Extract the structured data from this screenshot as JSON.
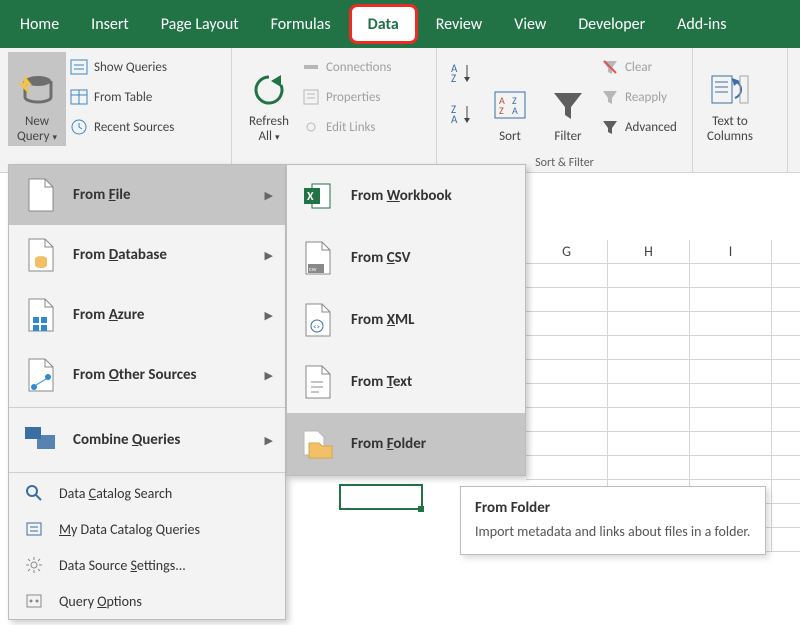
{
  "tabs": [
    "Home",
    "Insert",
    "Page Layout",
    "Formulas",
    "Data",
    "Review",
    "View",
    "Developer",
    "Add-ins"
  ],
  "active_tab_index": 4,
  "ribbon": {
    "new_query": {
      "label1": "New",
      "label2": "Query"
    },
    "show_queries": "Show Queries",
    "from_table": "From Table",
    "recent_sources": "Recent Sources",
    "refresh_all": {
      "label1": "Refresh",
      "label2": "All"
    },
    "connections": "Connections",
    "properties": "Properties",
    "edit_links": "Edit Links",
    "sort": "Sort",
    "filter": "Filter",
    "clear": "Clear",
    "reapply": "Reapply",
    "advanced": "Advanced",
    "sort_filter_group": "Sort & Filter",
    "text_to_columns": {
      "label1": "Text to",
      "label2": "Columns"
    }
  },
  "menu1": [
    {
      "label_pre": "From ",
      "accel": "F",
      "label_post": "ile",
      "bold": true
    },
    {
      "label_pre": "From ",
      "accel": "D",
      "label_post": "atabase",
      "bold": true
    },
    {
      "label_pre": "From ",
      "accel": "A",
      "label_post": "zure",
      "bold": true
    },
    {
      "label_pre": "From ",
      "accel": "O",
      "label_post": "ther Sources",
      "bold": true
    },
    {
      "label_pre": "Combine ",
      "accel": "Q",
      "label_post": "ueries",
      "bold": true
    }
  ],
  "menu1_small": [
    {
      "pre": "Data ",
      "accel": "C",
      "post": "atalog Search"
    },
    {
      "accel": "M",
      "post": "y Data Catalog Queries"
    },
    {
      "pre": "Data Source ",
      "accel": "S",
      "post": "ettings..."
    },
    {
      "pre": "Query ",
      "accel": "O",
      "post": "ptions"
    }
  ],
  "menu2": [
    {
      "pre": "From ",
      "accel": "W",
      "post": "orkbook"
    },
    {
      "pre": "From ",
      "accel": "C",
      "post": "SV"
    },
    {
      "pre": "From ",
      "accel": "X",
      "post": "ML"
    },
    {
      "pre": "From ",
      "accel": "T",
      "post": "ext"
    },
    {
      "pre": "From ",
      "accel": "F",
      "post": "older",
      "hover": true
    }
  ],
  "tooltip": {
    "title": "From Folder",
    "body": "Import metadata and links about files in a folder."
  },
  "columns": [
    "G",
    "H",
    "I"
  ],
  "colors": {
    "accent": "#217346"
  }
}
